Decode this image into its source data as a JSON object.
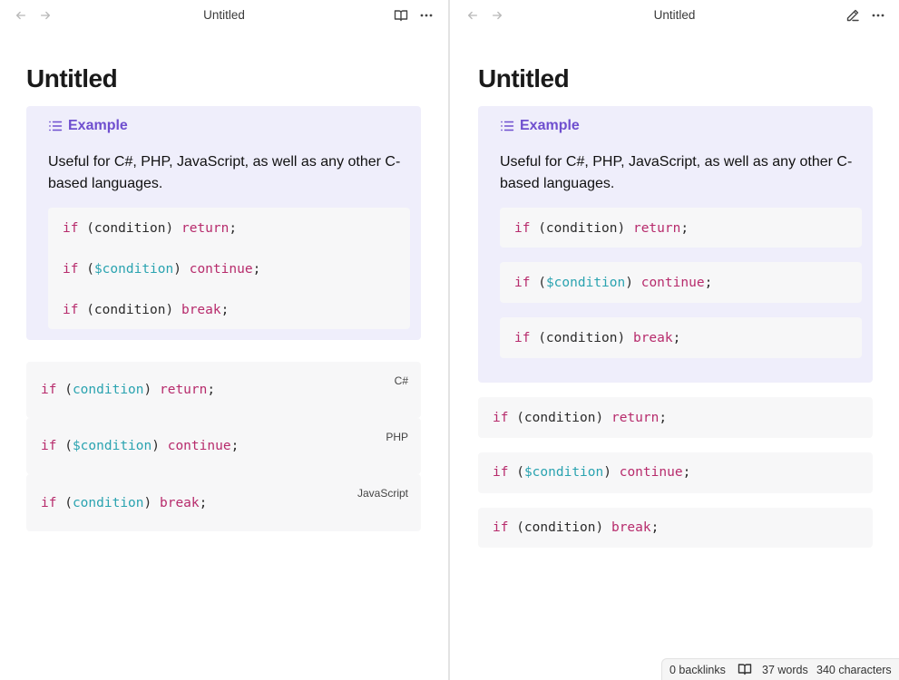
{
  "left_pane": {
    "tab_title": "Untitled",
    "note_title": "Untitled",
    "callout": {
      "title": "Example",
      "body": "Useful for C#, PHP, JavaScript, as well as any other C-based languages.",
      "code": [
        [
          {
            "t": "if",
            "c": "kw"
          },
          {
            "t": " (condition) ",
            "c": "plain"
          },
          {
            "t": "return",
            "c": "kw"
          },
          {
            "t": ";",
            "c": "plain"
          }
        ],
        [
          {
            "t": "if",
            "c": "kw"
          },
          {
            "t": " (",
            "c": "plain"
          },
          {
            "t": "$condition",
            "c": "var"
          },
          {
            "t": ") ",
            "c": "plain"
          },
          {
            "t": "continue",
            "c": "kw"
          },
          {
            "t": ";",
            "c": "plain"
          }
        ],
        [
          {
            "t": "if",
            "c": "kw"
          },
          {
            "t": " (condition) ",
            "c": "plain"
          },
          {
            "t": "break",
            "c": "kw"
          },
          {
            "t": ";",
            "c": "plain"
          }
        ]
      ]
    },
    "code_blocks": [
      {
        "lang": "C#",
        "tokens": [
          {
            "t": "if",
            "c": "kw"
          },
          {
            "t": " (",
            "c": "plain"
          },
          {
            "t": "condition",
            "c": "var"
          },
          {
            "t": ") ",
            "c": "plain"
          },
          {
            "t": "return",
            "c": "kw"
          },
          {
            "t": ";",
            "c": "plain"
          }
        ]
      },
      {
        "lang": "PHP",
        "tokens": [
          {
            "t": "if",
            "c": "kw"
          },
          {
            "t": " (",
            "c": "plain"
          },
          {
            "t": "$condition",
            "c": "var"
          },
          {
            "t": ") ",
            "c": "plain"
          },
          {
            "t": "continue",
            "c": "kw"
          },
          {
            "t": ";",
            "c": "plain"
          }
        ]
      },
      {
        "lang": "JavaScript",
        "tokens": [
          {
            "t": "if",
            "c": "kw"
          },
          {
            "t": " (",
            "c": "plain"
          },
          {
            "t": "condition",
            "c": "var"
          },
          {
            "t": ") ",
            "c": "plain"
          },
          {
            "t": "break",
            "c": "kw"
          },
          {
            "t": ";",
            "c": "plain"
          }
        ]
      }
    ]
  },
  "right_pane": {
    "tab_title": "Untitled",
    "note_title": "Untitled",
    "callout": {
      "title": "Example",
      "body": "Useful for C#, PHP, JavaScript, as well as any other C-based languages.",
      "code": [
        [
          {
            "t": "if",
            "c": "kw"
          },
          {
            "t": " (condition) ",
            "c": "plain"
          },
          {
            "t": "return",
            "c": "kw"
          },
          {
            "t": ";",
            "c": "plain"
          }
        ],
        [
          {
            "t": "if",
            "c": "kw"
          },
          {
            "t": " (",
            "c": "plain"
          },
          {
            "t": "$condition",
            "c": "var"
          },
          {
            "t": ") ",
            "c": "plain"
          },
          {
            "t": "continue",
            "c": "kw"
          },
          {
            "t": ";",
            "c": "plain"
          }
        ],
        [
          {
            "t": "if",
            "c": "kw"
          },
          {
            "t": " (condition) ",
            "c": "plain"
          },
          {
            "t": "break",
            "c": "kw"
          },
          {
            "t": ";",
            "c": "plain"
          }
        ]
      ]
    },
    "code_blocks": [
      {
        "tokens": [
          {
            "t": "if",
            "c": "kw"
          },
          {
            "t": " (condition) ",
            "c": "plain"
          },
          {
            "t": "return",
            "c": "kw"
          },
          {
            "t": ";",
            "c": "plain"
          }
        ]
      },
      {
        "tokens": [
          {
            "t": "if",
            "c": "kw"
          },
          {
            "t": " (",
            "c": "plain"
          },
          {
            "t": "$condition",
            "c": "var"
          },
          {
            "t": ") ",
            "c": "plain"
          },
          {
            "t": "continue",
            "c": "kw"
          },
          {
            "t": ";",
            "c": "plain"
          }
        ]
      },
      {
        "tokens": [
          {
            "t": "if",
            "c": "kw"
          },
          {
            "t": " (condition) ",
            "c": "plain"
          },
          {
            "t": "break",
            "c": "kw"
          },
          {
            "t": ";",
            "c": "plain"
          }
        ]
      }
    ]
  },
  "status_bar": {
    "backlinks": "0 backlinks",
    "words": "37 words",
    "characters": "340 characters"
  },
  "icons": {
    "back": "arrow-left-icon",
    "forward": "arrow-right-icon",
    "reading_view": "book-open-icon",
    "edit": "pencil-icon",
    "more": "more-options-icon",
    "callout": "list-icon"
  },
  "colors": {
    "keyword": "#b72b6c",
    "variable": "#2aa3b0",
    "callout_bg": "#efeefb",
    "callout_title": "#6f4fcf",
    "code_bg": "#f7f7f8"
  }
}
